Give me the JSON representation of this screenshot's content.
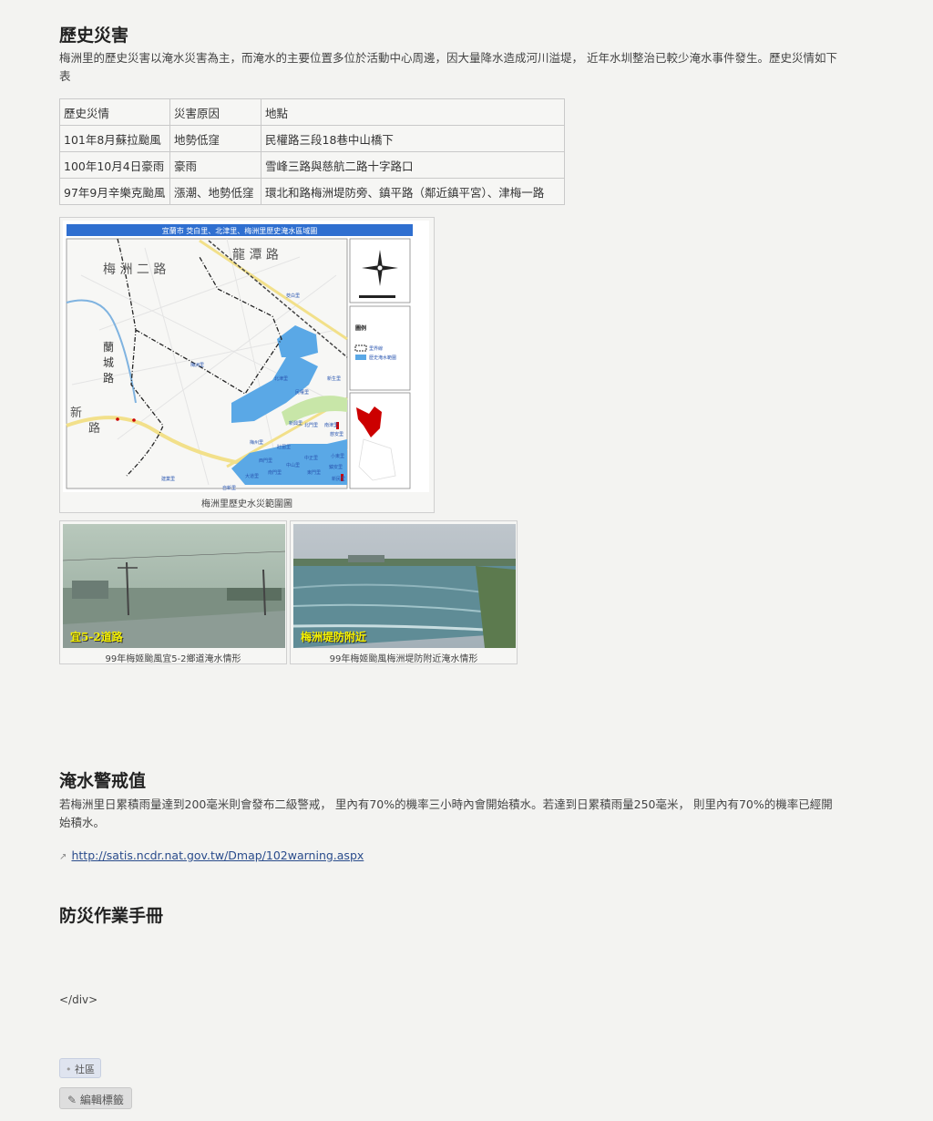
{
  "sections": {
    "history": {
      "heading": "歷史災害",
      "intro": "梅洲里的歷史災害以淹水災害為主，而淹水的主要位置多位於活動中心周邊，因大量降水造成河川溢堤， 近年水圳整治已較少淹水事件發生。歷史災情如下表",
      "table": {
        "headers": [
          "歷史災情",
          "災害原因",
          "地點"
        ],
        "rows": [
          [
            "101年8月蘇拉颱風",
            "地勢低窪",
            "民權路三段18巷中山橋下"
          ],
          [
            "100年10月4日豪雨",
            "豪雨",
            "雪峰三路與慈航二路十字路口"
          ],
          [
            "97年9月辛樂克颱風",
            "漲潮、地勢低窪",
            "環北和路梅洲堤防旁、鎮平路（鄰近鎮平宮）、津梅一路"
          ]
        ]
      },
      "map": {
        "title_bar": "宜蘭市 茭白里、北津里、梅洲里歷史淹水區域圖",
        "road_labels": [
          "梅 洲 二 路",
          "龍 潭 路",
          "蘭",
          "城",
          "路",
          "新",
          "路"
        ],
        "place_labels": [
          "梅洲里",
          "北津里",
          "新生里",
          "中山里",
          "西門里",
          "南門里",
          "東門里",
          "中正里",
          "鎮安里",
          "慈安里",
          "茭白里",
          "建業里",
          "新興里",
          "大道里",
          "南津里",
          "壯圍里",
          "北門里",
          "小東里",
          "民權里",
          "新民里",
          "梅州里",
          "自新里"
        ],
        "legend_title": "圖例",
        "legend_items": [
          "里界線",
          "歷史淹水範圍"
        ],
        "caption": "梅洲里歷史水災範圍圖"
      },
      "photos": [
        {
          "overlay": "宜5-2道路",
          "caption": "99年梅姬颱風宜5-2鄉道淹水情形"
        },
        {
          "overlay": "梅洲堤防附近",
          "caption": "99年梅姬颱風梅洲堤防附近淹水情形"
        }
      ]
    },
    "warning": {
      "heading": "淹水警戒值",
      "text": "若梅洲里日累積雨量達到200毫米則會發布二級警戒， 里內有70%的機率三小時內會開始積水。若達到日累積雨量250毫米， 則里內有70%的機率已經開始積水。",
      "link": "http://satis.ncdr.nat.gov.tw/Dmap/102warning.aspx"
    },
    "manual": {
      "heading": "防災作業手冊"
    }
  },
  "stray_text": "</div>",
  "tags": {
    "category": "社區",
    "edit_label": "編輯標籤"
  },
  "colors": {
    "flood": "#5aa8e6",
    "highlight": "#cc0000",
    "link": "#2a4c8c",
    "page_bg": "#f3f3f1"
  },
  "icons": {
    "external_link": "external-link-icon",
    "tag": "tag-icon",
    "compass": "compass-icon"
  }
}
